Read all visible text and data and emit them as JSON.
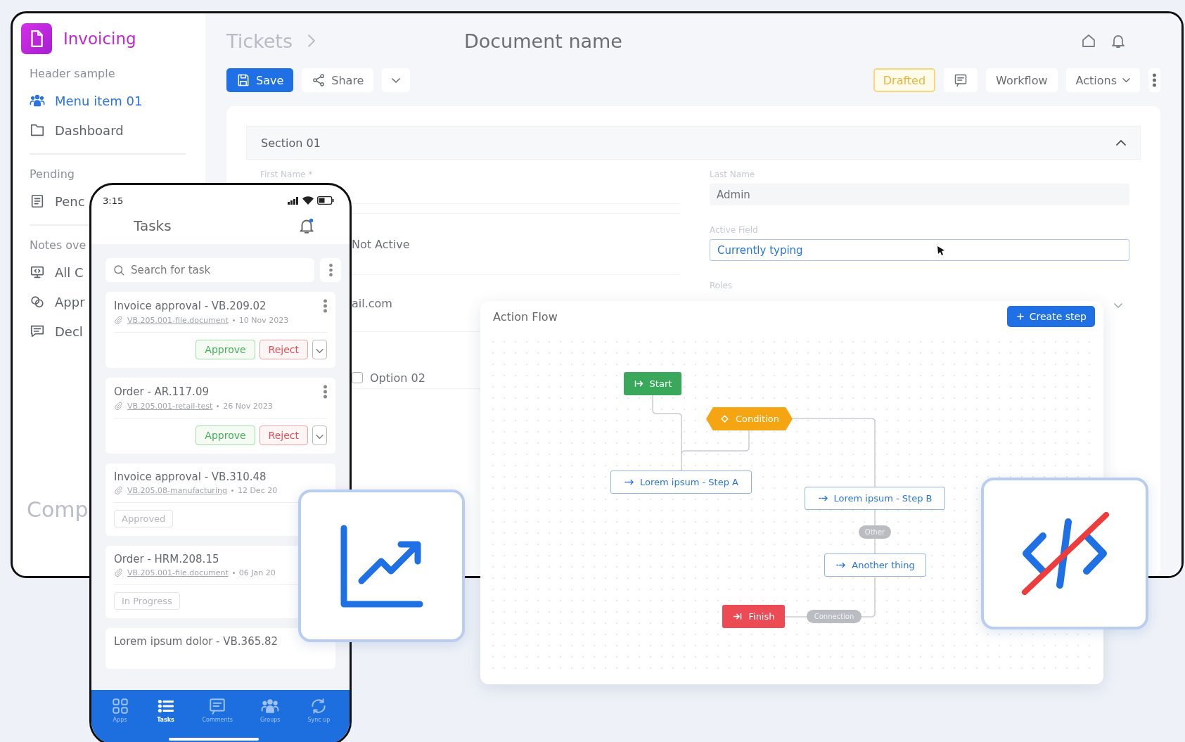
{
  "sidebar": {
    "app_name": "Invoicing",
    "groups": [
      {
        "header": "Header sample",
        "items": [
          {
            "label": "Menu item 01",
            "selected": true
          },
          {
            "label": "Dashboard",
            "selected": false
          }
        ]
      },
      {
        "header": "Pending",
        "items": [
          {
            "label": "Penc",
            "selected": false
          }
        ]
      },
      {
        "header": "Notes ove",
        "items": [
          {
            "label": "All C",
            "selected": false
          },
          {
            "label": "Appr",
            "selected": false
          },
          {
            "label": "Decl",
            "selected": false
          }
        ]
      }
    ],
    "footer": "Comp"
  },
  "breadcrumb": [
    {
      "label": "Tickets",
      "current": false
    },
    {
      "label": "Document name",
      "current": true
    }
  ],
  "toolbar": {
    "save": "Save",
    "share": "Share",
    "status": "Drafted",
    "workflow": "Workflow",
    "actions": "Actions"
  },
  "form": {
    "section": "Section 01",
    "expanded": true,
    "left": [
      {
        "kind": "text",
        "label": "First Name *"
      },
      {
        "kind": "value",
        "value": "Not Active"
      },
      {
        "kind": "value",
        "value": "ail.com"
      },
      {
        "kind": "checkbox",
        "label": "Option 02",
        "checked": false
      }
    ],
    "right": [
      {
        "kind": "readonly",
        "label": "Last Name",
        "value": "Admin"
      },
      {
        "kind": "active",
        "label": "Active Field",
        "value": "Currently typing"
      },
      {
        "kind": "select",
        "label": "Roles"
      }
    ]
  },
  "phone": {
    "time": "3:15",
    "title": "Tasks",
    "search_placeholder": "Search for task",
    "tasks": [
      {
        "kind": "actions",
        "title": "Invoice approval - VB.209.02",
        "file": "VB.205.001-file.document",
        "date": "10 Nov 2023",
        "approve": "Approve",
        "reject": "Reject"
      },
      {
        "kind": "actions",
        "title": "Order - AR.117.09",
        "file": "VB.205.001-retail-test",
        "date": "26 Nov 2023",
        "approve": "Approve",
        "reject": "Reject"
      },
      {
        "kind": "status",
        "title": "Invoice approval - VB.310.48",
        "file": "VB.205.08-manufacturing",
        "date": "12 Dec 20",
        "status": "Approved"
      },
      {
        "kind": "status",
        "title": "Order - HRM.208.15",
        "file": "VB.205.001-file.document",
        "date": "06 Jan 20",
        "status": "In Progress"
      },
      {
        "kind": "partial",
        "title": "Lorem ipsum dolor - VB.365.82"
      }
    ],
    "tabs": [
      {
        "label": "Apps",
        "selected": false
      },
      {
        "label": "Tasks",
        "selected": true
      },
      {
        "label": "Comments",
        "selected": false
      },
      {
        "label": "Groups",
        "selected": false
      },
      {
        "label": "Sync up",
        "selected": false
      }
    ]
  },
  "flow": {
    "title": "Action Flow",
    "create": "Create step",
    "nodes": [
      {
        "kind": "start",
        "label": "Start"
      },
      {
        "kind": "condition",
        "label": "Condition"
      },
      {
        "kind": "step",
        "label": "Lorem ipsum - Step A"
      },
      {
        "kind": "step",
        "label": "Lorem ipsum - Step B"
      },
      {
        "kind": "step",
        "label": "Another thing"
      },
      {
        "kind": "finish",
        "label": "Finish"
      }
    ],
    "edge_labels": [
      "Other",
      "Connection"
    ]
  }
}
